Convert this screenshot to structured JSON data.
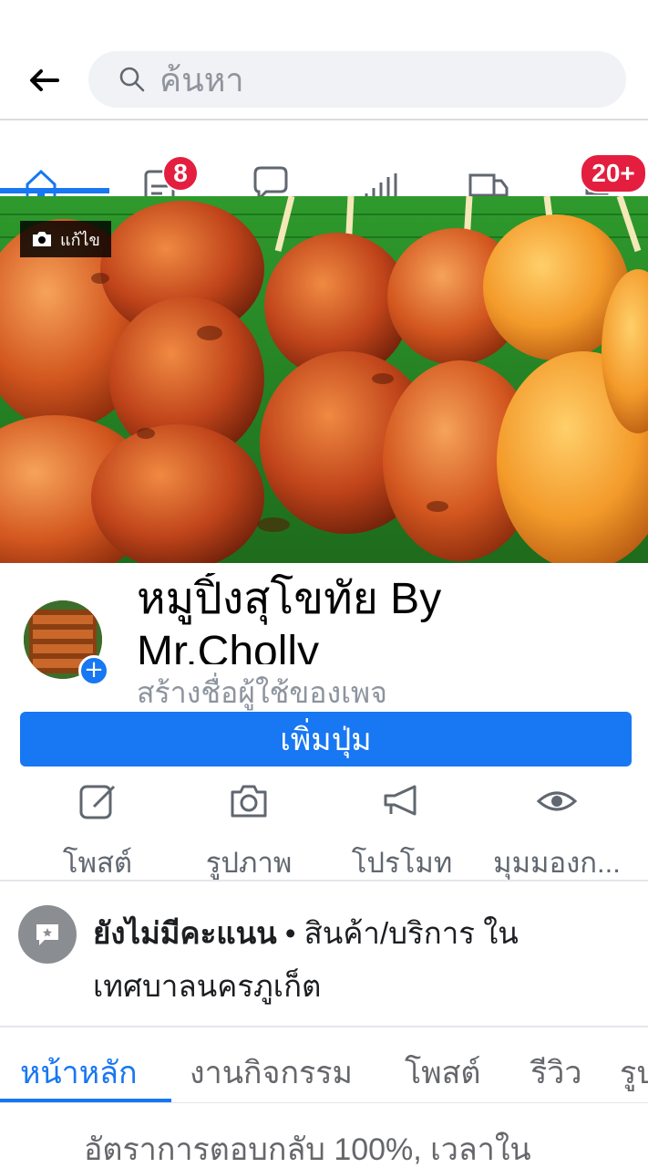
{
  "search": {
    "placeholder": "ค้นหา"
  },
  "icon_tabs": [
    {
      "icon": "home-icon"
    },
    {
      "icon": "messages-icon",
      "badge": "8"
    },
    {
      "icon": "chat-icon"
    },
    {
      "icon": "insights-icon"
    },
    {
      "icon": "delivery-truck-icon"
    },
    {
      "icon": "notifications-icon",
      "badge": "20+"
    }
  ],
  "cover": {
    "edit_label": "แก้ไข"
  },
  "page": {
    "name_line1": "หมูปิ้งสุโขทัย By",
    "name_line2": "Mr.Cholly",
    "username_prompt": "สร้างชื่อผู้ใช้ของเพจ"
  },
  "add_button_label": "เพิ่มปุ่ม",
  "actions": [
    {
      "icon": "edit-post-icon",
      "label": "โพสต์"
    },
    {
      "icon": "camera-icon",
      "label": "รูปภาพ"
    },
    {
      "icon": "megaphone-icon",
      "label": "โปรโมท"
    },
    {
      "icon": "eye-icon",
      "label": "มุมมองก..."
    }
  ],
  "info": {
    "rating": "ยังไม่มีคะแนน",
    "separator": " • ",
    "category": "สินค้า/บริการ ใน",
    "location": "เทศบาลนครภูเก็ต"
  },
  "tabs": [
    "หน้าหลัก",
    "งานกิจกรรม",
    "โพสต์",
    "รีวิว",
    "รูป"
  ],
  "response_text": "อัตราการตอบกลับ 100%, เวลาใน",
  "colors": {
    "accent": "#1877f2",
    "badge": "#e41e3f"
  }
}
